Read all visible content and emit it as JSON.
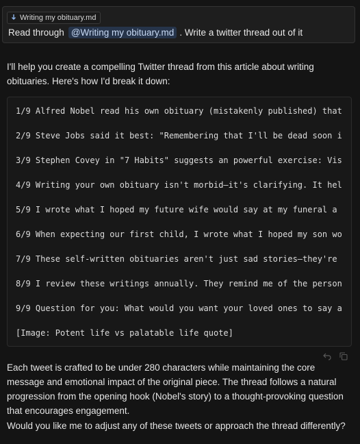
{
  "user_message": {
    "attachment": {
      "icon": "markdown-file-icon",
      "label": "Writing my obituary.md"
    },
    "text_before": "Read through",
    "mention": "@Writing my obituary.md",
    "text_after": ". Write a twitter thread out of it"
  },
  "assistant": {
    "intro": "I'll help you create a compelling Twitter thread from this article about writing obituaries. Here's how I'd break it down:",
    "thread_lines": [
      "1/9 Alfred Nobel read his own obituary (mistakenly published) that",
      "2/9 Steve Jobs said it best: \"Remembering that I'll be dead soon i",
      "3/9 Stephen Covey in \"7 Habits\" suggests an powerful exercise: Vis",
      "4/9 Writing your own obituary isn't morbid—it's clarifying. It hel",
      "5/9 I wrote what I hoped my future wife would say at my funeral a",
      "6/9 When expecting our first child, I wrote what I hoped my son wo",
      "7/9 These self-written obituaries aren't just sad stories—they're",
      "8/9 I review these writings annually. They remind me of the person",
      "9/9 Question for you: What would you want your loved ones to say a",
      "[Image: Potent life vs palatable life quote]"
    ],
    "summary": "Each tweet is crafted to be under 280 characters while maintaining the core message and emotional impact of the original piece. The thread follows a natural progression from the opening hook (Nobel's story) to a thought-provoking question that encourages engagement.",
    "followup": "Would you like me to adjust any of these tweets or approach the thread differently?"
  },
  "actions": {
    "undo_icon": "undo-icon",
    "copy_icon": "copy-icon"
  },
  "colors": {
    "background": "#141414",
    "mention_bg": "#26344a",
    "mention_text": "#c7d9f4"
  }
}
